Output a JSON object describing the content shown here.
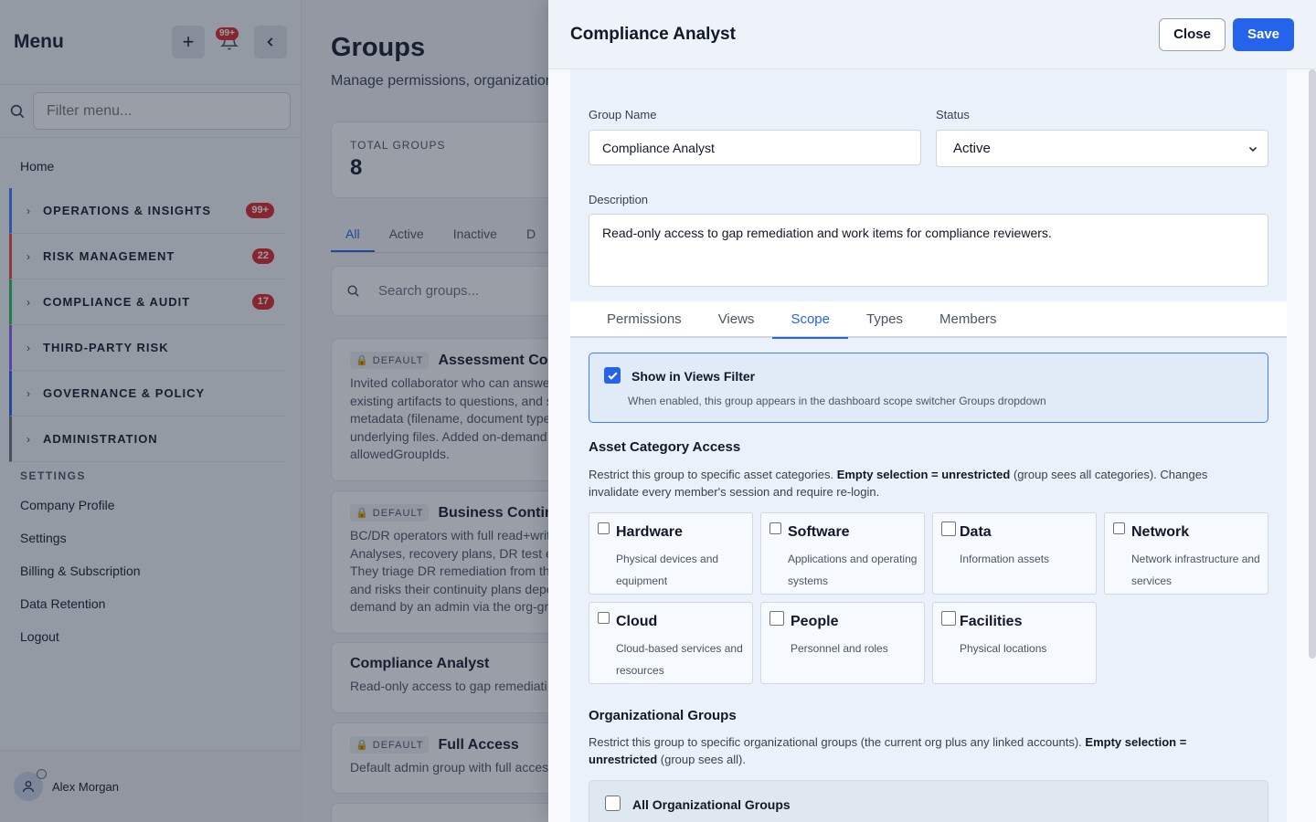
{
  "sidebar": {
    "title": "Menu",
    "notification_count": "99+",
    "filter_placeholder": "Filter menu...",
    "home": "Home",
    "sections": [
      {
        "label": "OPERATIONS & INSIGHTS",
        "count": "99+",
        "color": "#3b82f6"
      },
      {
        "label": "RISK MANAGEMENT",
        "count": "22",
        "color": "#ef4444"
      },
      {
        "label": "COMPLIANCE & AUDIT",
        "count": "17",
        "color": "#22c55e"
      },
      {
        "label": "THIRD-PARTY RISK",
        "count": "",
        "color": "#8b5cf6"
      },
      {
        "label": "GOVERNANCE & POLICY",
        "count": "",
        "color": "#2563eb"
      },
      {
        "label": "ADMINISTRATION",
        "count": "",
        "color": "#6b7280"
      }
    ],
    "settings_header": "SETTINGS",
    "settings_links": [
      "Company Profile",
      "Settings",
      "Billing & Subscription",
      "Data Retention",
      "Logout"
    ],
    "user_name": "Alex Morgan"
  },
  "main": {
    "title": "Groups",
    "subtitle": "Manage permissions, organization",
    "stat_label": "TOTAL GROUPS",
    "stat_value": "8",
    "filter_tabs": [
      "All",
      "Active",
      "Inactive",
      "D"
    ],
    "search_placeholder": "Search groups...",
    "cards": [
      {
        "tag": "DEFAULT",
        "name": "Assessment Cont",
        "desc": [
          "Invited collaborator who can answe",
          "existing artifacts to questions, and s",
          "metadata (filename, document type",
          "underlying files. Added on-demand",
          "allowedGroupIds."
        ]
      },
      {
        "tag": "DEFAULT",
        "name": "Business Continu",
        "desc": [
          "BC/DR operators with full read+writ",
          "Analyses, recovery plans, DR test e",
          "They triage DR remediation from th",
          "and risks their continuity plans depe",
          "demand by an admin via the org-gr"
        ]
      },
      {
        "tag": "",
        "name": "Compliance Analyst",
        "desc": [
          "Read-only access to gap remediati"
        ]
      },
      {
        "tag": "DEFAULT",
        "name": "Full Access",
        "desc": [
          "Default admin group with full acces"
        ]
      }
    ]
  },
  "drawer": {
    "title": "Compliance Analyst",
    "close_label": "Close",
    "save_label": "Save",
    "group_name_label": "Group Name",
    "group_name_value": "Compliance Analyst",
    "status_label": "Status",
    "status_value": "Active",
    "description_label": "Description",
    "description_value": "Read-only access to gap remediation and work items for compliance reviewers.",
    "tabs": [
      "Permissions",
      "Views",
      "Scope",
      "Types",
      "Members"
    ],
    "active_tab": "Scope",
    "views_filter": {
      "checked": true,
      "title": "Show in Views Filter",
      "subtitle": "When enabled, this group appears in the dashboard scope switcher Groups dropdown"
    },
    "asset_access": {
      "title": "Asset Category Access",
      "desc_1": "Restrict this group to specific asset categories.",
      "desc_bold": "Empty selection = unrestricted",
      "desc_2": "(group sees all categories). Changes",
      "desc_3": "invalidate every member's session and require re-login.",
      "categories": [
        {
          "name": "Hardware",
          "desc": "Physical devices and equipment",
          "checked": false
        },
        {
          "name": "Software",
          "desc": "Applications and operating systems",
          "checked": false
        },
        {
          "name": "Data",
          "desc": "Information assets",
          "checked": false
        },
        {
          "name": "Network",
          "desc": "Network infrastructure and services",
          "checked": false
        },
        {
          "name": "Cloud",
          "desc": "Cloud-based services and resources",
          "checked": false
        },
        {
          "name": "People",
          "desc": "Personnel and roles",
          "checked": false
        },
        {
          "name": "Facilities",
          "desc": "Physical locations",
          "checked": false
        }
      ]
    },
    "org_groups": {
      "title": "Organizational Groups",
      "desc_1": "Restrict this group to specific organizational groups (the current org plus any linked accounts).",
      "desc_bold_1": "Empty selection =",
      "desc_bold_2": "unrestricted",
      "desc_2": "(group sees all).",
      "all_label": "All Organizational Groups"
    }
  },
  "colors": {
    "accent": "#2563eb",
    "badge": "#dc2626"
  }
}
